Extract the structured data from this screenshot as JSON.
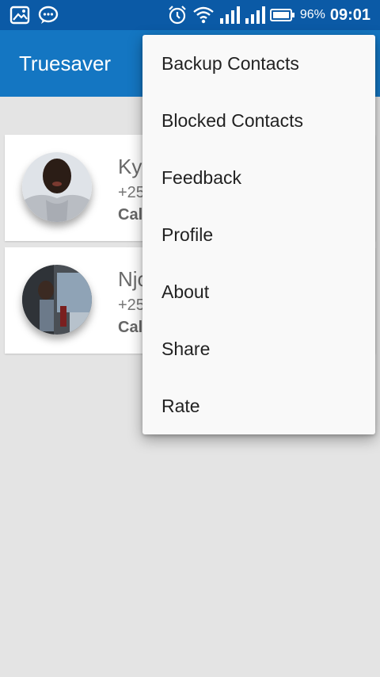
{
  "status_bar": {
    "left_icons": [
      "gallery-icon",
      "chat-bubble-icon"
    ],
    "right_icons": [
      "alarm-icon",
      "wifi-icon",
      "signal-icon",
      "signal-icon",
      "battery-icon"
    ],
    "battery_percent": "96%",
    "time": "09:01"
  },
  "app_bar": {
    "title": "Truesaver"
  },
  "contacts": [
    {
      "name": "Ky",
      "phone": "+25",
      "call_status": "Cal"
    },
    {
      "name": "Njo",
      "phone": "+25",
      "call_status": "Cal"
    }
  ],
  "menu": {
    "items": [
      "Backup Contacts",
      "Blocked Contacts",
      "Feedback",
      "Profile",
      "About",
      "Share",
      "Rate"
    ]
  },
  "colors": {
    "status_bar": "#0b5aa6",
    "app_bar": "#1476c2",
    "background": "#e4e4e4",
    "menu_background": "#f9f9f9"
  }
}
